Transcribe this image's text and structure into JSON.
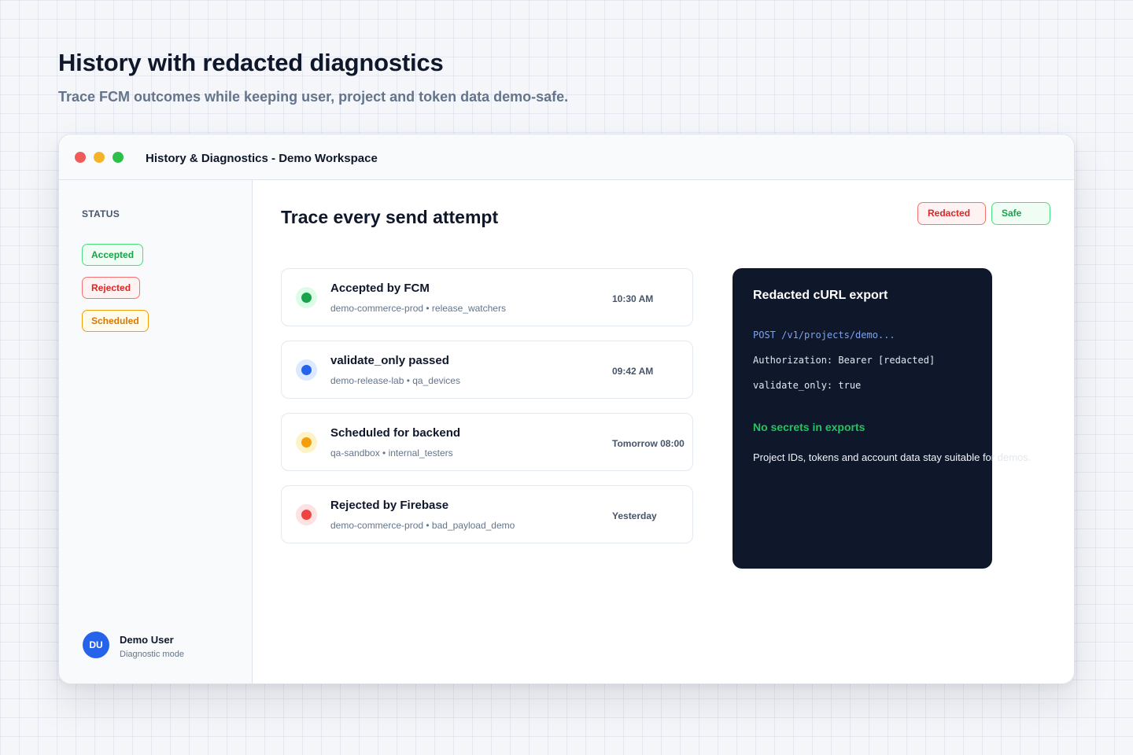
{
  "hero": {
    "title": "History with redacted diagnostics",
    "subtitle": "Trace FCM outcomes while keeping user, project and token data demo-safe."
  },
  "window": {
    "title": "History & Diagnostics - Demo Workspace"
  },
  "sidebar": {
    "heading": "STATUS",
    "filters": [
      {
        "label": "Accepted",
        "color": "#16a34a"
      },
      {
        "label": "Rejected",
        "color": "#dc2626"
      },
      {
        "label": "Scheduled",
        "color": "#d97706"
      }
    ],
    "user": {
      "initials": "DU",
      "name": "Demo User",
      "mode": "Diagnostic mode"
    }
  },
  "main": {
    "title": "Trace every send attempt",
    "badges": [
      {
        "label": "Redacted",
        "color": "#dc2626"
      },
      {
        "label": "Safe",
        "color": "#16a34a"
      }
    ],
    "attempts": [
      {
        "title": "Accepted by FCM",
        "subtitle": "demo-commerce-prod • release_watchers",
        "time": "10:30 AM",
        "status_color": "#16a34a"
      },
      {
        "title": "validate_only passed",
        "subtitle": "demo-release-lab • qa_devices",
        "time": "09:42 AM",
        "status_color": "#2563eb"
      },
      {
        "title": "Scheduled for backend",
        "subtitle": "qa-sandbox • internal_testers",
        "time": "Tomorrow 08:00",
        "status_color": "#f59e0b"
      },
      {
        "title": "Rejected by Firebase",
        "subtitle": "demo-commerce-prod • bad_payload_demo",
        "time": "Yesterday",
        "status_color": "#ef4444"
      }
    ]
  },
  "export": {
    "title": "Redacted cURL export",
    "lines": [
      "POST /v1/projects/demo...",
      "Authorization: Bearer [redacted]",
      "validate_only: true"
    ],
    "safe_heading": "No secrets in exports",
    "safe_text_start": "Project IDs, tokens and account data stay suitable fo",
    "safe_text_end": "r demos."
  }
}
